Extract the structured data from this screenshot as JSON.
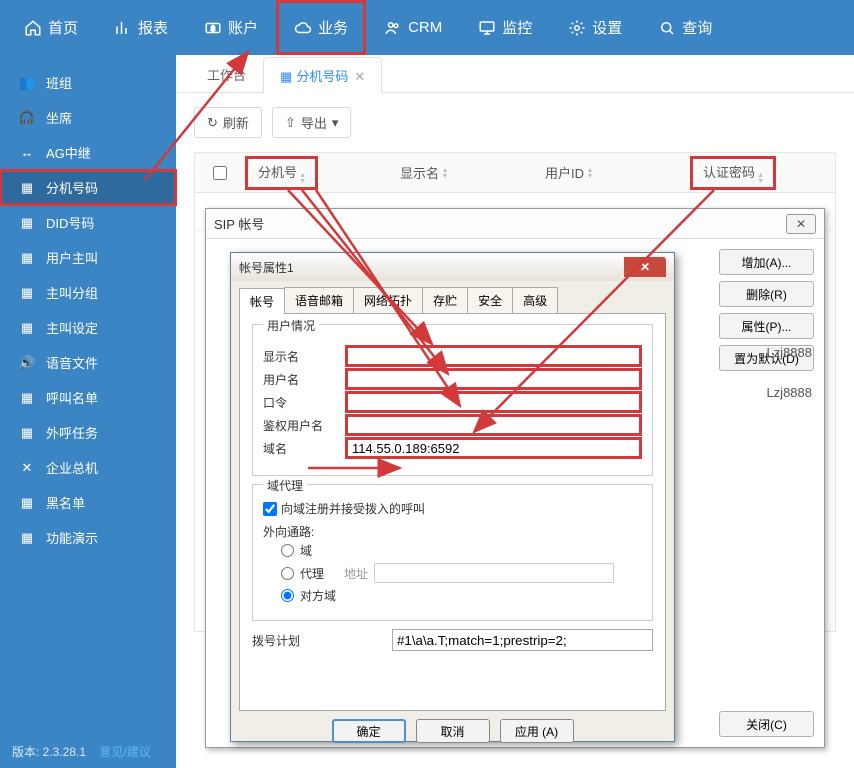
{
  "topnav": [
    {
      "label": "首页",
      "icon": "home"
    },
    {
      "label": "报表",
      "icon": "chart"
    },
    {
      "label": "账户",
      "icon": "money"
    },
    {
      "label": "业务",
      "icon": "cloud",
      "active": true
    },
    {
      "label": "CRM",
      "icon": "people"
    },
    {
      "label": "监控",
      "icon": "monitor"
    },
    {
      "label": "设置",
      "icon": "gear"
    },
    {
      "label": "查询",
      "icon": "search"
    }
  ],
  "sidebar": [
    {
      "label": "班组"
    },
    {
      "label": "坐席"
    },
    {
      "label": "AG中继"
    },
    {
      "label": "分机号码",
      "selected": true
    },
    {
      "label": "DID号码"
    },
    {
      "label": "用户主叫"
    },
    {
      "label": "主叫分组"
    },
    {
      "label": "主叫设定"
    },
    {
      "label": "语音文件"
    },
    {
      "label": "呼叫名单"
    },
    {
      "label": "外呼任务"
    },
    {
      "label": "企业总机"
    },
    {
      "label": "黑名单"
    },
    {
      "label": "功能演示"
    }
  ],
  "version_label": "版本: 2.3.28.1",
  "feedback_label": "意见/建议",
  "tabs": [
    {
      "label": "工作台"
    },
    {
      "label": "分机号码",
      "active": true,
      "closable": true
    }
  ],
  "toolbar": {
    "refresh": "刷新",
    "export": "导出"
  },
  "columns": {
    "c2": "分机号",
    "c3": "显示名",
    "c4": "用户ID",
    "c5": "认证密码"
  },
  "panel": {
    "title": "SIP 帐号",
    "buttons": {
      "add": "增加(A)...",
      "del": "删除(R)",
      "prop": "属性(P)...",
      "default": "置为默认(D)",
      "close": "关闭(C)"
    }
  },
  "dialog": {
    "title": "帐号属性1",
    "tabs": [
      "帐号",
      "语音邮箱",
      "网络拓扑",
      "存贮",
      "安全",
      "高级"
    ],
    "group_user": "用户情况",
    "fields": {
      "display": "显示名",
      "user": "用户名",
      "pass": "口令",
      "auth": "鉴权用户名",
      "domain": "域名"
    },
    "domain_value": "114.55.0.189:6592",
    "group_proxy": "域代理",
    "chk_register": "向域注册并接受拨入的呼叫",
    "outbound_label": "外向通路:",
    "radios": {
      "domain": "域",
      "proxy": "代理",
      "address_label": "地址",
      "target": "对方域"
    },
    "dialplan_label": "拨号计划",
    "dialplan_value": "#1\\a\\a.T;match=1;prestrip=2;",
    "footer": {
      "ok": "确定",
      "cancel": "取消",
      "apply": "应用 (A)"
    }
  },
  "sample_rows": {
    "r1": "Lzj8888",
    "r2": "Lzj8888"
  }
}
